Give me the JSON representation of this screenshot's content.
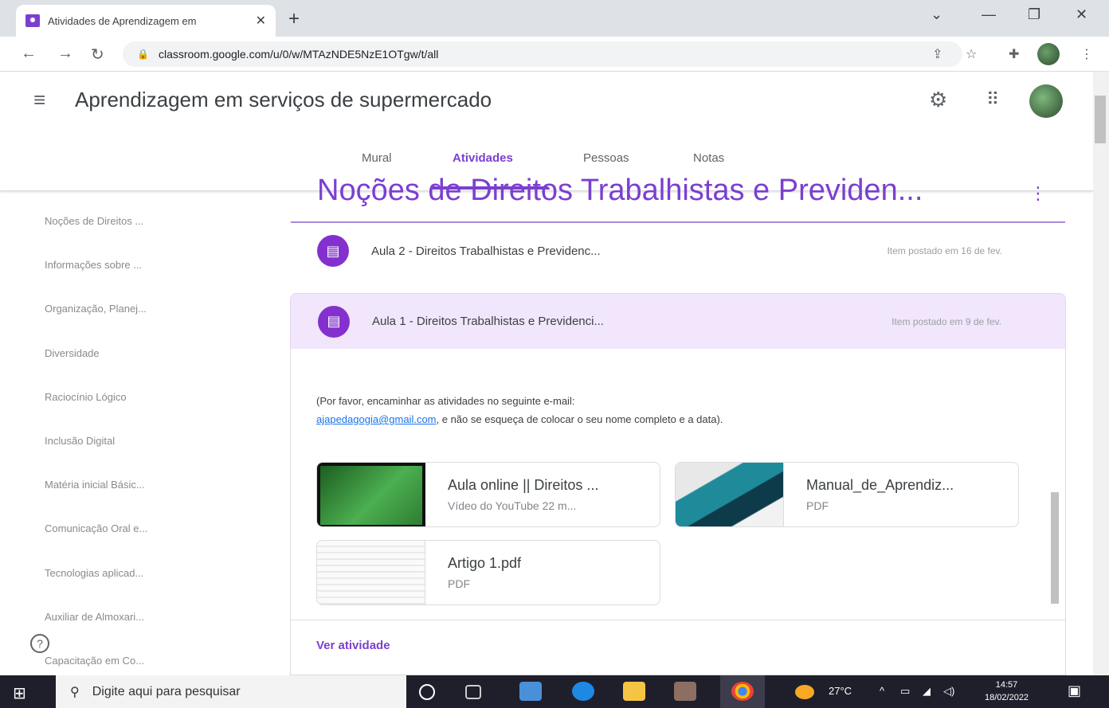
{
  "browser": {
    "tab_title": "Atividades de Aprendizagem em",
    "tab_close": "✕",
    "new_tab": "+",
    "url": "classroom.google.com/u/0/w/MTAzNDE5NzE1OTgw/t/all",
    "win_min": "—",
    "win_max": "❐",
    "win_close": "✕",
    "win_down": "⌄"
  },
  "header": {
    "class_title": "Aprendizagem em serviços de supermercado",
    "tabs": [
      {
        "label": "Mural"
      },
      {
        "label": "Atividades"
      },
      {
        "label": "Pessoas"
      },
      {
        "label": "Notas"
      }
    ]
  },
  "sidebar": {
    "items": [
      "Noções de Direitos ...",
      "Informações sobre ...",
      "Organização, Planej...",
      "Diversidade",
      "Raciocínio Lógico",
      "Inclusão Digital",
      "Matéria inicial Básic...",
      "Comunicação Oral e...",
      "Tecnologias aplicad...",
      "Auxiliar de Almoxari...",
      "Capacitação em Co..."
    ]
  },
  "main": {
    "topic": "Noções de Direitos Trabalhistas e Previden...",
    "items": [
      {
        "title": "Aula 2 - Direitos Trabalhistas e Previdenc...",
        "date": "Item postado em 16 de fev."
      },
      {
        "title": "Aula 1 - Direitos Trabalhistas e Previdenci...",
        "date": "Item postado em 9 de fev."
      }
    ],
    "description_1": "(Por favor, encaminhar as atividades no seguinte e-mail:",
    "email": "ajapedagogia@gmail.com",
    "description_2": ", e não se esqueça de colocar o seu nome completo e a data).",
    "attachments": [
      {
        "title": "Aula online || Direitos ...",
        "subtitle": "Vídeo do YouTube   22 m..."
      },
      {
        "title": "Manual_de_Aprendiz...",
        "subtitle": "PDF"
      },
      {
        "title": "Artigo 1.pdf",
        "subtitle": "PDF"
      }
    ],
    "view_activity": "Ver atividade"
  },
  "taskbar": {
    "search_placeholder": "Digite aqui para pesquisar",
    "temperature": "27°C",
    "time": "14:57",
    "date": "18/02/2022"
  },
  "colors": {
    "accent": "#7b3fd0",
    "item_icon": "#8430ce",
    "selected_bg": "#f1e6fb"
  }
}
